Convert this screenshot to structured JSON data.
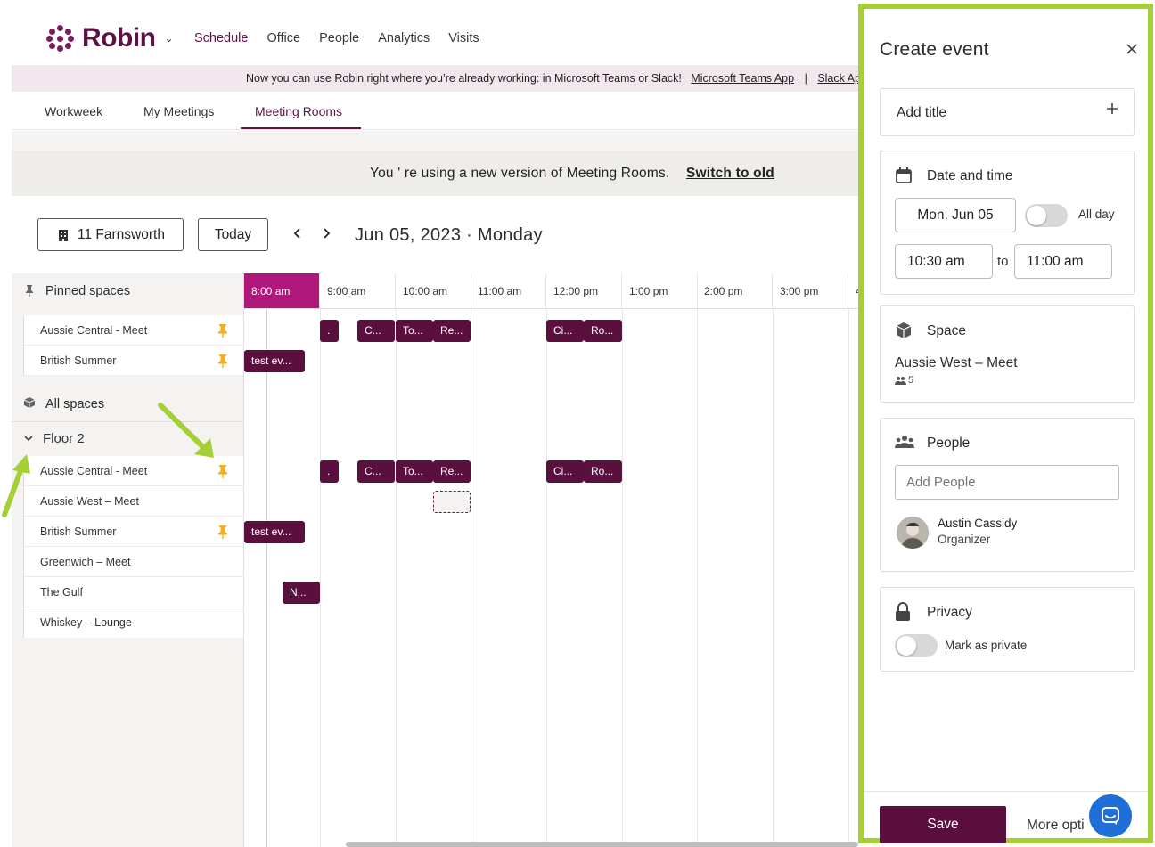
{
  "app": {
    "brand": "Robin",
    "nav": [
      "Schedule",
      "Office",
      "People",
      "Analytics",
      "Visits"
    ],
    "active_nav": "Schedule"
  },
  "banner": {
    "text": "Now you can use Robin right where you’re already working: in Microsoft Teams or Slack!",
    "link_teams": "Microsoft Teams App",
    "separator": "|",
    "link_slack": "Slack App"
  },
  "subtabs": {
    "items": [
      "Workweek",
      "My Meetings",
      "Meeting Rooms"
    ],
    "active": "Meeting Rooms"
  },
  "notice": {
    "text": "You ' re using a new version of Meeting Rooms.",
    "link": "Switch to old"
  },
  "toolbar": {
    "building": "11 Farnsworth",
    "today": "Today",
    "prev": "‹",
    "next": "›",
    "date": "Jun 05, 2023 · Monday"
  },
  "sidebar": {
    "pinned_title": "Pinned spaces",
    "pinned": [
      "Aussie Central - Meet",
      "British Summer"
    ],
    "all_title": "All spaces",
    "floor": "Floor 2",
    "floor_spaces": [
      "Aussie Central - Meet",
      "Aussie West – Meet",
      "British Summer",
      "Greenwich – Meet",
      "The Gulf",
      "Whiskey – Lounge"
    ]
  },
  "timeline": {
    "hours": [
      "8:00 am",
      "9:00 am",
      "10:00 am",
      "11:00 am",
      "12:00 pm",
      "1:00 pm",
      "2:00 pm",
      "3:00 pm",
      "4"
    ],
    "event_labels": {
      "dot": ".",
      "c": "C...",
      "to": "To...",
      "re": "Re...",
      "ci": "Ci...",
      "ro": "Ro...",
      "test": "test ev...",
      "n": "N..."
    }
  },
  "panel": {
    "title": "Create event",
    "add_title": "Add title",
    "date_time_title": "Date and time",
    "date": "Mon, Jun 05",
    "all_day": "All day",
    "start": "10:30 am",
    "to": "to",
    "end": "11:00 am",
    "space_title": "Space",
    "space_name": "Aussie West – Meet",
    "space_capacity": "5",
    "people_title": "People",
    "people_placeholder": "Add People",
    "organizer_name": "Austin Cassidy",
    "organizer_role": "Organizer",
    "privacy_title": "Privacy",
    "private_label": "Mark as private",
    "save": "Save",
    "more_options": "More opti"
  },
  "colors": {
    "brand": "#5b1346",
    "event": "#5b0f3f",
    "now_header": "#b0177a",
    "highlight": "#a5cf37",
    "pin": "#f2b01e",
    "chat": "#1f6fd8"
  }
}
